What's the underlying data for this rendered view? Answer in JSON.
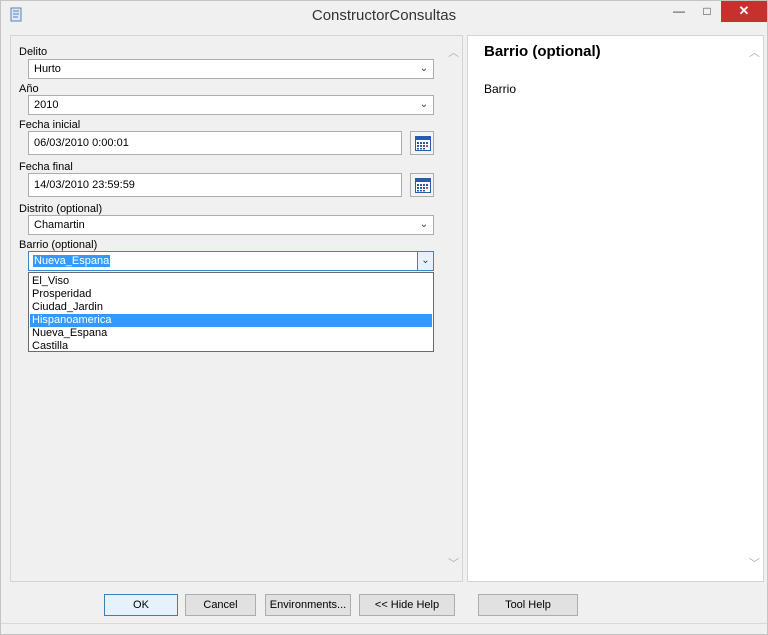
{
  "window": {
    "title": "ConstructorConsultas"
  },
  "titlebar": {
    "minimize": "—",
    "maximize": "□",
    "close": "✕"
  },
  "form": {
    "delito": {
      "label": "Delito",
      "value": "Hurto"
    },
    "anio": {
      "label": "Año",
      "value": "2010"
    },
    "fecha_inicial": {
      "label": "Fecha inicial",
      "value": "06/03/2010 0:00:01"
    },
    "fecha_final": {
      "label": "Fecha final",
      "value": "14/03/2010 23:59:59"
    },
    "distrito": {
      "label": "Distrito (optional)",
      "value": "Chamartin"
    },
    "barrio": {
      "label": "Barrio (optional)",
      "value": "Nueva_Espana",
      "options": [
        "El_Viso",
        "Prosperidad",
        "Ciudad_Jardin",
        "Hispanoamerica",
        "Nueva_Espana",
        "Castilla"
      ],
      "highlighted": "Hispanoamerica"
    }
  },
  "help": {
    "title": "Barrio (optional)",
    "body": "Barrio"
  },
  "buttons": {
    "ok": "OK",
    "cancel": "Cancel",
    "environments": "Environments...",
    "hide_help": "<< Hide Help",
    "tool_help": "Tool Help"
  },
  "icons": {
    "app": "script-icon",
    "dropdown": "chevron-down-icon",
    "calendar": "calendar-icon",
    "scroll_up": "chevron-up-icon",
    "scroll_down": "chevron-down-icon"
  },
  "colors": {
    "selection": "#3399ff",
    "close_button": "#c7312d",
    "focus_border": "#3b84d2"
  }
}
